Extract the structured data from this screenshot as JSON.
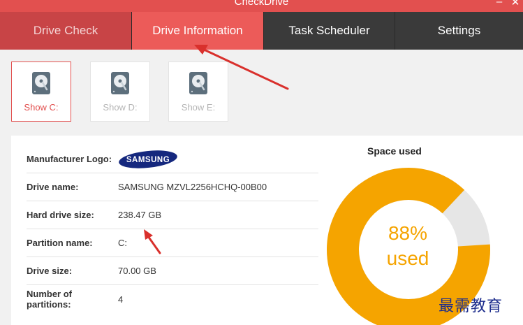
{
  "window": {
    "title": "CheckDrive",
    "minimize": "–",
    "close": "✕"
  },
  "nav": {
    "tabs": [
      {
        "label": "Drive Check"
      },
      {
        "label": "Drive Information"
      },
      {
        "label": "Task Scheduler"
      },
      {
        "label": "Settings"
      }
    ],
    "active_tab": "Drive Information"
  },
  "drives": [
    {
      "label": "Show C:",
      "selected": true
    },
    {
      "label": "Show D:",
      "selected": false
    },
    {
      "label": "Show E:",
      "selected": false
    }
  ],
  "info": {
    "rows": [
      {
        "key": "Manufacturer Logo:",
        "logo_text": "SAMSUNG"
      },
      {
        "key": "Drive name:",
        "value": "SAMSUNG MZVL2256HCHQ-00B00"
      },
      {
        "key": "Hard drive size:",
        "value": "238.47 GB"
      },
      {
        "key": "Partition name:",
        "value": "C:"
      },
      {
        "key": "Drive size:",
        "value": "70.00 GB"
      },
      {
        "key": "Number of partitions:",
        "value": "4"
      }
    ]
  },
  "space": {
    "title": "Space used",
    "percent_text": "88%",
    "used_text": "used",
    "used_fraction": 0.88
  },
  "colors": {
    "accent": "#e2504f",
    "dark_tab": "#3a3a3a",
    "donut_used": "#f5a400",
    "donut_free": "#e6e6e6",
    "annotation_arrow": "#d9302c"
  },
  "watermark": "最需教育"
}
